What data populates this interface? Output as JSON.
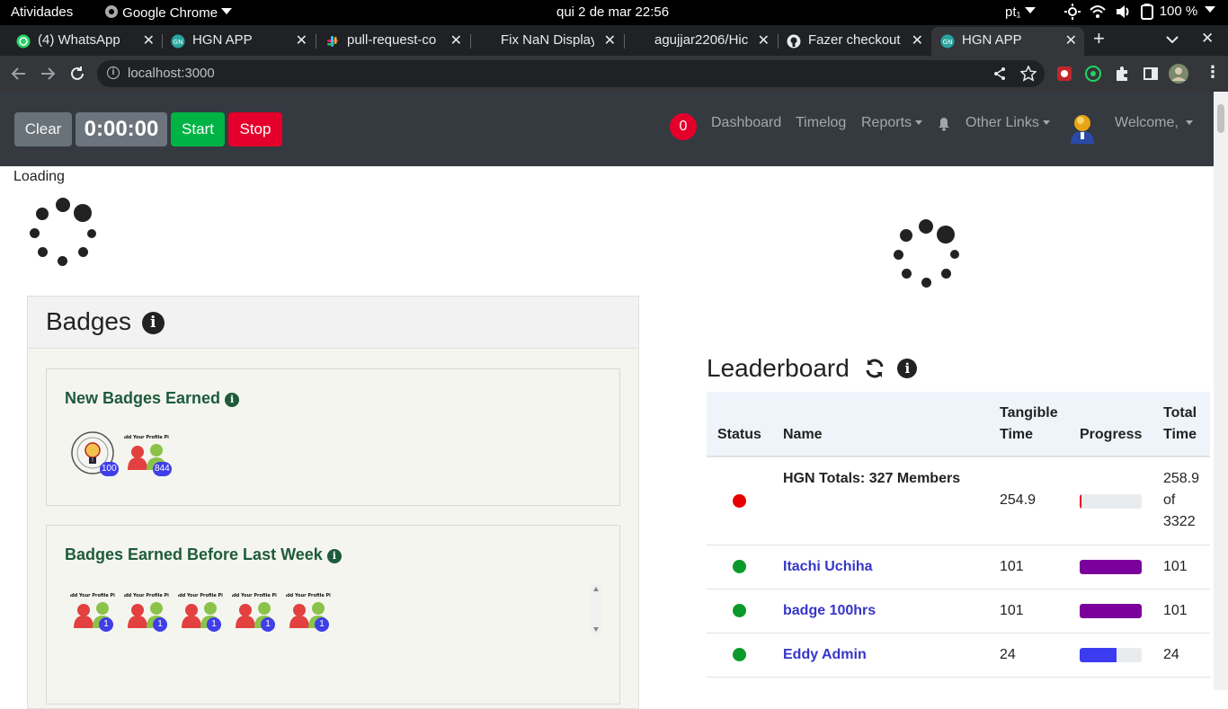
{
  "os_bar": {
    "activities": "Atividades",
    "app": "Google Chrome",
    "clock": "qui 2 de mar  22:56",
    "lang": "pt₁",
    "battery": "100 %"
  },
  "tabs": [
    {
      "label": "(4) WhatsApp",
      "icon": "whatsapp-icon"
    },
    {
      "label": "HGN APP",
      "icon": "hgn-icon"
    },
    {
      "label": "pull-request-co",
      "icon": "slack-icon"
    },
    {
      "label": "Fix NaN Display",
      "icon": "none"
    },
    {
      "label": "agujjar2206/Hic",
      "icon": "none"
    },
    {
      "label": "Fazer checkout",
      "icon": "github-icon"
    },
    {
      "label": "HGN APP",
      "icon": "hgn-icon",
      "active": true
    }
  ],
  "address": {
    "url": "localhost:3000"
  },
  "header": {
    "clear": "Clear",
    "timer": "0:00:00",
    "start": "Start",
    "stop": "Stop",
    "notif_count": "0",
    "dashboard": "Dashboard",
    "timelog": "Timelog",
    "reports": "Reports",
    "other_links": "Other Links",
    "welcome": "Welcome,",
    "colors": {
      "clear": "#6c757d",
      "timer": "#6c757d",
      "start": "#00b345",
      "stop": "#e4002b",
      "badge": "#e4002b"
    }
  },
  "loading": "Loading",
  "badges": {
    "title": "Badges",
    "new_title": "New Badges Earned",
    "new_counts": [
      "100",
      "844"
    ],
    "before_title": "Badges Earned Before Last Week",
    "before_counts": [
      "1",
      "1",
      "1",
      "1",
      "1"
    ]
  },
  "leaderboard": {
    "title": "Leaderboard",
    "columns": {
      "status": "Status",
      "name": "Name",
      "tangible_1": "Tangible",
      "tangible_2": "Time",
      "progress": "Progress",
      "total_1": "Total",
      "total_2": "Time"
    },
    "totals": {
      "name": "HGN Totals: 327 Members",
      "tangible": "254.9",
      "total_1": "258.9",
      "total_2": "of",
      "total_3": "3322",
      "status_color": "#e60000",
      "progress": 0.03,
      "bar_color": "#e4002b"
    },
    "rows": [
      {
        "name": "Itachi Uchiha",
        "tangible": "101",
        "total": "101",
        "status_color": "#0a9a2b",
        "progress": 1.0,
        "bar_color": "#7b009b"
      },
      {
        "name": "badge 100hrs",
        "tangible": "101",
        "total": "101",
        "status_color": "#0a9a2b",
        "progress": 1.0,
        "bar_color": "#7b009b"
      },
      {
        "name": "Eddy Admin",
        "tangible": "24",
        "total": "24",
        "status_color": "#0a9a2b",
        "progress": 0.6,
        "bar_color": "#3b3bf0"
      }
    ]
  }
}
